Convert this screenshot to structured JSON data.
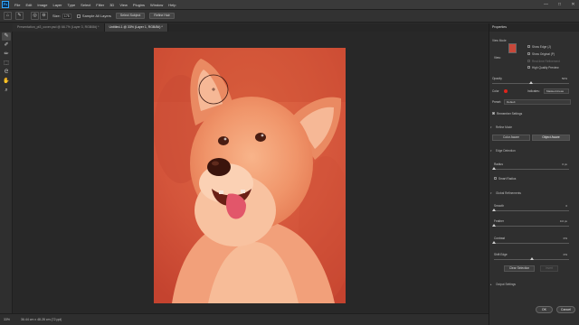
{
  "app": {
    "logo": "Ps",
    "menu": [
      "File",
      "Edit",
      "Image",
      "Layer",
      "Type",
      "Select",
      "Filter",
      "3D",
      "View",
      "Plugins",
      "Window",
      "Help"
    ],
    "window_controls": [
      "—",
      "□",
      "✕"
    ]
  },
  "options_bar": {
    "size_label": "Size:",
    "size_value": "175",
    "sample_label": "Sample All Layers",
    "select_subject": "Select Subject",
    "refine_hair": "Refine Hair"
  },
  "tabs": [
    "Presentation_pt3_cover.psd @ 66.7% (Layer 3, RGB/8#) *",
    "Untitled-1 @ 33% (Layer 1, RGB/8#) *"
  ],
  "status": {
    "zoom": "33%",
    "size": "36.44 cm x 48.28 cm (72 ppi)"
  },
  "panel": {
    "title": "Properties",
    "view_mode_label": "View Mode",
    "view_label": "View:",
    "show_edge": "Show Edge (J)",
    "show_original": "Show Original (P)",
    "realtime_refinement": "Real-time Refinement",
    "high_quality_preview": "High Quality Preview",
    "opacity_label": "Opacity",
    "opacity_value": "50%",
    "color_label": "Color",
    "indicates_label": "Indicates:",
    "indicates_value": "Masked Areas",
    "preset_label": "Preset:",
    "preset_value": "Default",
    "remember_settings": "Remember Settings",
    "refine_mode": "Refine Mode",
    "color_aware": "Color Aware",
    "object_aware": "Object Aware",
    "edge_detection": "Edge Detection",
    "radius_label": "Radius",
    "radius_value": "0 px",
    "smart_radius": "Smart Radius",
    "global_refinements": "Global Refinements",
    "smooth_label": "Smooth",
    "smooth_value": "0",
    "feather_label": "Feather",
    "feather_value": "0.0 px",
    "contrast_label": "Contrast",
    "contrast_value": "0%",
    "shift_edge_label": "Shift Edge",
    "shift_edge_value": "0%",
    "clear_selection": "Clear Selection",
    "invert": "Invert",
    "output_settings": "Output Settings",
    "ok": "OK",
    "cancel": "Cancel",
    "levels": {
      "opacity": 0.5,
      "radius": 0.0,
      "smooth": 0.0,
      "feather": 0.0,
      "contrast": 0.0,
      "shift_edge": 0.5
    }
  },
  "colors": {
    "overlay": "#d8553c",
    "overlay_color_swatch": "#e0241b",
    "accent": "#31a8ff"
  },
  "icons": [
    "quick-selection-icon",
    "refine-edge-brush-icon",
    "brush-icon",
    "object-selection-icon",
    "lasso-icon",
    "hand-icon",
    "zoom-icon"
  ]
}
